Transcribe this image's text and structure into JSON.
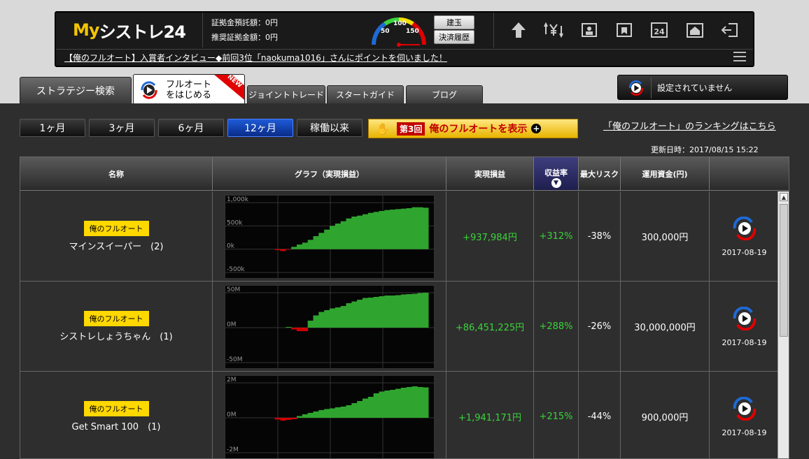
{
  "header": {
    "logo_my": "My",
    "logo_rest": "シストレ24",
    "deposit_label": "証拠金預託額：",
    "deposit_value": "0円",
    "recommended_label": "推奨証拠金額：",
    "recommended_value": "0円",
    "gauge": {
      "l50": "50",
      "l100": "100",
      "l150": "150"
    },
    "btn_tategyoku": "建玉",
    "btn_kessai": "決済履歴",
    "icons": [
      "up-arrow-icon",
      "yen-exchange-icon",
      "profile-icon",
      "book-icon",
      "24-icon",
      "home-icon",
      "logout-icon"
    ],
    "news": "【俺のフルオート】入賞者インタビュー◆前回3位「naokuma1016」さんにポイントを伺いました！"
  },
  "tabs": {
    "search": "ストラテジー検索",
    "fullauto_line1": "フルオート",
    "fullauto_line2": "をはじめる",
    "new_badge": "NEW",
    "joint": "ジョイントトレード",
    "guide": "スタートガイド",
    "blog": "ブログ"
  },
  "strategy_status": "設定されていません",
  "periods": [
    "1ヶ月",
    "3ヶ月",
    "6ヶ月",
    "12ヶ月",
    "稼働以来"
  ],
  "active_period": "12ヶ月",
  "banner": {
    "num": "第3回",
    "text": "俺のフルオートを表示",
    "plus": "+"
  },
  "ranking_link": "「俺のフルオート」のランキングはこちら",
  "updated": "更新日時：2017/08/15 15:22",
  "table": {
    "headers": {
      "name": "名称",
      "graph": "グラフ（実現損益）",
      "pnl": "実現損益",
      "ret": "収益率",
      "risk": "最大リスク",
      "fund": "運用資金(円)"
    },
    "sort_arrow": "▼",
    "badge": "俺のフルオート",
    "rows": [
      {
        "name": "マインスイーパー　(2)",
        "pnl": "+937,984円",
        "ret": "+312%",
        "risk": "-38%",
        "fund": "300,000円",
        "date": "2017-08-19",
        "axis": [
          "1,000k",
          "500k",
          "0k",
          "-500k"
        ],
        "axis_values": [
          1000,
          500,
          0,
          -500
        ]
      },
      {
        "name": "シストレしょうちゃん　(1)",
        "pnl": "+86,451,225円",
        "ret": "+288%",
        "risk": "-26%",
        "fund": "30,000,000円",
        "date": "2017-08-19",
        "axis": [
          "50M",
          "0M",
          "-50M"
        ],
        "axis_values": [
          50,
          0,
          -50
        ]
      },
      {
        "name": "Get Smart 100　(1)",
        "pnl": "+1,941,171円",
        "ret": "+215%",
        "risk": "-44%",
        "fund": "900,000円",
        "date": "2017-08-19",
        "axis": [
          "2M",
          "0M",
          "-2M"
        ],
        "axis_values": [
          2,
          0,
          -2
        ]
      }
    ]
  },
  "colors": {
    "accent": "#f3c400",
    "positive": "#3bd43b",
    "negative": "#d00000",
    "active_period": "#1e5ad6"
  }
}
